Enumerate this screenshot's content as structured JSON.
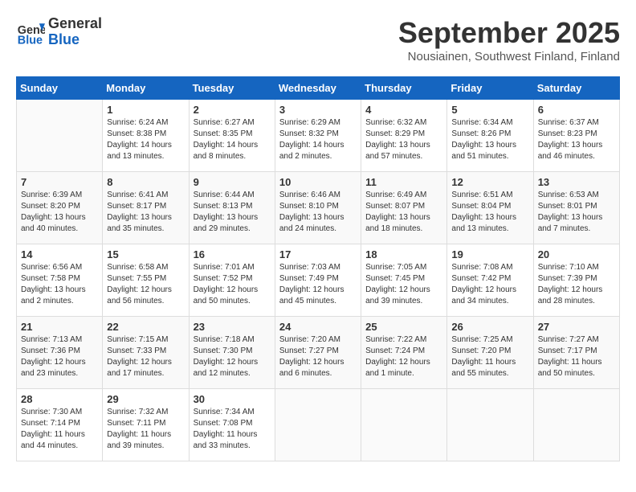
{
  "header": {
    "logo_line1": "General",
    "logo_line2": "Blue",
    "month_title": "September 2025",
    "location": "Nousiainen, Southwest Finland, Finland"
  },
  "days_of_week": [
    "Sunday",
    "Monday",
    "Tuesday",
    "Wednesday",
    "Thursday",
    "Friday",
    "Saturday"
  ],
  "weeks": [
    [
      {
        "day": "",
        "info": ""
      },
      {
        "day": "1",
        "info": "Sunrise: 6:24 AM\nSunset: 8:38 PM\nDaylight: 14 hours\nand 13 minutes."
      },
      {
        "day": "2",
        "info": "Sunrise: 6:27 AM\nSunset: 8:35 PM\nDaylight: 14 hours\nand 8 minutes."
      },
      {
        "day": "3",
        "info": "Sunrise: 6:29 AM\nSunset: 8:32 PM\nDaylight: 14 hours\nand 2 minutes."
      },
      {
        "day": "4",
        "info": "Sunrise: 6:32 AM\nSunset: 8:29 PM\nDaylight: 13 hours\nand 57 minutes."
      },
      {
        "day": "5",
        "info": "Sunrise: 6:34 AM\nSunset: 8:26 PM\nDaylight: 13 hours\nand 51 minutes."
      },
      {
        "day": "6",
        "info": "Sunrise: 6:37 AM\nSunset: 8:23 PM\nDaylight: 13 hours\nand 46 minutes."
      }
    ],
    [
      {
        "day": "7",
        "info": "Sunrise: 6:39 AM\nSunset: 8:20 PM\nDaylight: 13 hours\nand 40 minutes."
      },
      {
        "day": "8",
        "info": "Sunrise: 6:41 AM\nSunset: 8:17 PM\nDaylight: 13 hours\nand 35 minutes."
      },
      {
        "day": "9",
        "info": "Sunrise: 6:44 AM\nSunset: 8:13 PM\nDaylight: 13 hours\nand 29 minutes."
      },
      {
        "day": "10",
        "info": "Sunrise: 6:46 AM\nSunset: 8:10 PM\nDaylight: 13 hours\nand 24 minutes."
      },
      {
        "day": "11",
        "info": "Sunrise: 6:49 AM\nSunset: 8:07 PM\nDaylight: 13 hours\nand 18 minutes."
      },
      {
        "day": "12",
        "info": "Sunrise: 6:51 AM\nSunset: 8:04 PM\nDaylight: 13 hours\nand 13 minutes."
      },
      {
        "day": "13",
        "info": "Sunrise: 6:53 AM\nSunset: 8:01 PM\nDaylight: 13 hours\nand 7 minutes."
      }
    ],
    [
      {
        "day": "14",
        "info": "Sunrise: 6:56 AM\nSunset: 7:58 PM\nDaylight: 13 hours\nand 2 minutes."
      },
      {
        "day": "15",
        "info": "Sunrise: 6:58 AM\nSunset: 7:55 PM\nDaylight: 12 hours\nand 56 minutes."
      },
      {
        "day": "16",
        "info": "Sunrise: 7:01 AM\nSunset: 7:52 PM\nDaylight: 12 hours\nand 50 minutes."
      },
      {
        "day": "17",
        "info": "Sunrise: 7:03 AM\nSunset: 7:49 PM\nDaylight: 12 hours\nand 45 minutes."
      },
      {
        "day": "18",
        "info": "Sunrise: 7:05 AM\nSunset: 7:45 PM\nDaylight: 12 hours\nand 39 minutes."
      },
      {
        "day": "19",
        "info": "Sunrise: 7:08 AM\nSunset: 7:42 PM\nDaylight: 12 hours\nand 34 minutes."
      },
      {
        "day": "20",
        "info": "Sunrise: 7:10 AM\nSunset: 7:39 PM\nDaylight: 12 hours\nand 28 minutes."
      }
    ],
    [
      {
        "day": "21",
        "info": "Sunrise: 7:13 AM\nSunset: 7:36 PM\nDaylight: 12 hours\nand 23 minutes."
      },
      {
        "day": "22",
        "info": "Sunrise: 7:15 AM\nSunset: 7:33 PM\nDaylight: 12 hours\nand 17 minutes."
      },
      {
        "day": "23",
        "info": "Sunrise: 7:18 AM\nSunset: 7:30 PM\nDaylight: 12 hours\nand 12 minutes."
      },
      {
        "day": "24",
        "info": "Sunrise: 7:20 AM\nSunset: 7:27 PM\nDaylight: 12 hours\nand 6 minutes."
      },
      {
        "day": "25",
        "info": "Sunrise: 7:22 AM\nSunset: 7:24 PM\nDaylight: 12 hours\nand 1 minute."
      },
      {
        "day": "26",
        "info": "Sunrise: 7:25 AM\nSunset: 7:20 PM\nDaylight: 11 hours\nand 55 minutes."
      },
      {
        "day": "27",
        "info": "Sunrise: 7:27 AM\nSunset: 7:17 PM\nDaylight: 11 hours\nand 50 minutes."
      }
    ],
    [
      {
        "day": "28",
        "info": "Sunrise: 7:30 AM\nSunset: 7:14 PM\nDaylight: 11 hours\nand 44 minutes."
      },
      {
        "day": "29",
        "info": "Sunrise: 7:32 AM\nSunset: 7:11 PM\nDaylight: 11 hours\nand 39 minutes."
      },
      {
        "day": "30",
        "info": "Sunrise: 7:34 AM\nSunset: 7:08 PM\nDaylight: 11 hours\nand 33 minutes."
      },
      {
        "day": "",
        "info": ""
      },
      {
        "day": "",
        "info": ""
      },
      {
        "day": "",
        "info": ""
      },
      {
        "day": "",
        "info": ""
      }
    ]
  ]
}
